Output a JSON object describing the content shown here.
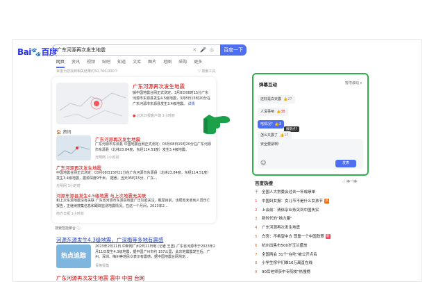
{
  "brand": {
    "logo_text": "Bai",
    "logo_text2": "百度"
  },
  "search": {
    "query": "广东河源再次发生地震",
    "button": "百度一下"
  },
  "tabs": [
    "网页",
    "资讯",
    "视频",
    "贴吧",
    "知道",
    "文库",
    "图片",
    "地图",
    "采购",
    "更多"
  ],
  "result_count": "百度为您找到相关结果约50,700,000个",
  "tools_label": "搜索工具",
  "card": {
    "title": "广东河源再次发生地震",
    "text": "據中国地震台网正式测定，3月8日08时15分广东河源市东源县发生4.5级地震，3月8日15时20分在广东河源市东源县发生3.4级地震。",
    "more": "详情",
    "source": "北京日报客户端 1小时前"
  },
  "news_header": "资讯",
  "news": [
    {
      "title": "广东河源再次发生地震",
      "text": "广东河源市东源县 中国地震台网正式测定：03月08日15时20分在广东河源市东源县（北纬23.84度，东经114.51度）发生3.4级地震。",
      "source": "光明网 1小时前"
    },
    {
      "title": "广东河源再次发生地震",
      "text": "中国地震台网正式测定：03月08日15时21分在广东河源市东源县（北纬23.84度，东经114.51度）发生3.4级地震，震源深度9千米。 据悉，当天05时15分，广东...",
      "source": "光明网 1小时前"
    },
    {
      "title": "河源东源县发生4.5级地震 与上次地震无关联",
      "text": "和上次东源地震没有关联 广东省河源市东源县地震广泛引起关注，截至目前，该局暂未收到人员伤亡报告，正继续搜集信息和跟踪监测地震情况。在这一个月间，2023年2...",
      "source": "南方日报 1小时前"
    }
  ],
  "smart_label": "搜索智能聚合",
  "result2": {
    "title": "河源东源发生4.3级地震，广深梅等多地有震感",
    "thumb": "热点追踪",
    "text": "2023年2月11日 中新网广州2月11日电 (记者 王坚) 广东省河源市于2023年2月11日发生4.3级地震，据中国广州市约 157公里，此次地震震发生后，广州、深圳、梅州等地民众表示有震感，据中国地震台网测定...",
    "source": "青瞳视角"
  },
  "result3_title": "广东河源再次发生地震 震中 中国 台网",
  "danmu": {
    "title": "弹幕互动",
    "pause": "暂停滚动",
    "items": [
      {
        "text": "还好是白天震",
        "likes": "27",
        "hot": false,
        "selected": false
      },
      {
        "text": "人没事吧",
        "likes": "38",
        "hot": true,
        "selected": false
      },
      {
        "text": "啥情况?",
        "likes": "3",
        "hot": false,
        "selected": true
      },
      {
        "text": "怎么又震了",
        "likes": "17",
        "hot": false,
        "selected": false
      }
    ],
    "tooltip": "撤销点?",
    "input_value": "安全要紧啊!",
    "send": "发表"
  },
  "hot": {
    "title": "百度热搜",
    "refresh": "换一换",
    "items": [
      {
        "rank": "干",
        "text": "全国人大常委会过去一年成绩单",
        "tag": ""
      },
      {
        "rank": "1",
        "text": "中国妇女报：女儿节不是什么女孩节",
        "tag": "热"
      },
      {
        "rank": "2",
        "text": "上会前：清徐杂业务突到中国失实",
        "tag": ""
      },
      {
        "rank": "3",
        "text": "新时代的\"她力量\"",
        "tag": ""
      },
      {
        "rank": "4",
        "text": "广东河源再次发生地震",
        "tag": ""
      },
      {
        "rank": "5",
        "text": "白宫：不希望中方 尊重一个中国政策",
        "tag": "新"
      },
      {
        "rank": "6",
        "text": "杭州出售市500岁玉兰盛放",
        "tag": ""
      },
      {
        "rank": "7",
        "text": "全国两会 31个\"在吃\"被公开点名",
        "tag": ""
      },
      {
        "rank": "8",
        "text": "小学生撑伞们维16万离直在线",
        "tag": ""
      },
      {
        "rank": "9",
        "text": "90后老师获中专院校\"热搜榜",
        "tag": ""
      }
    ]
  }
}
